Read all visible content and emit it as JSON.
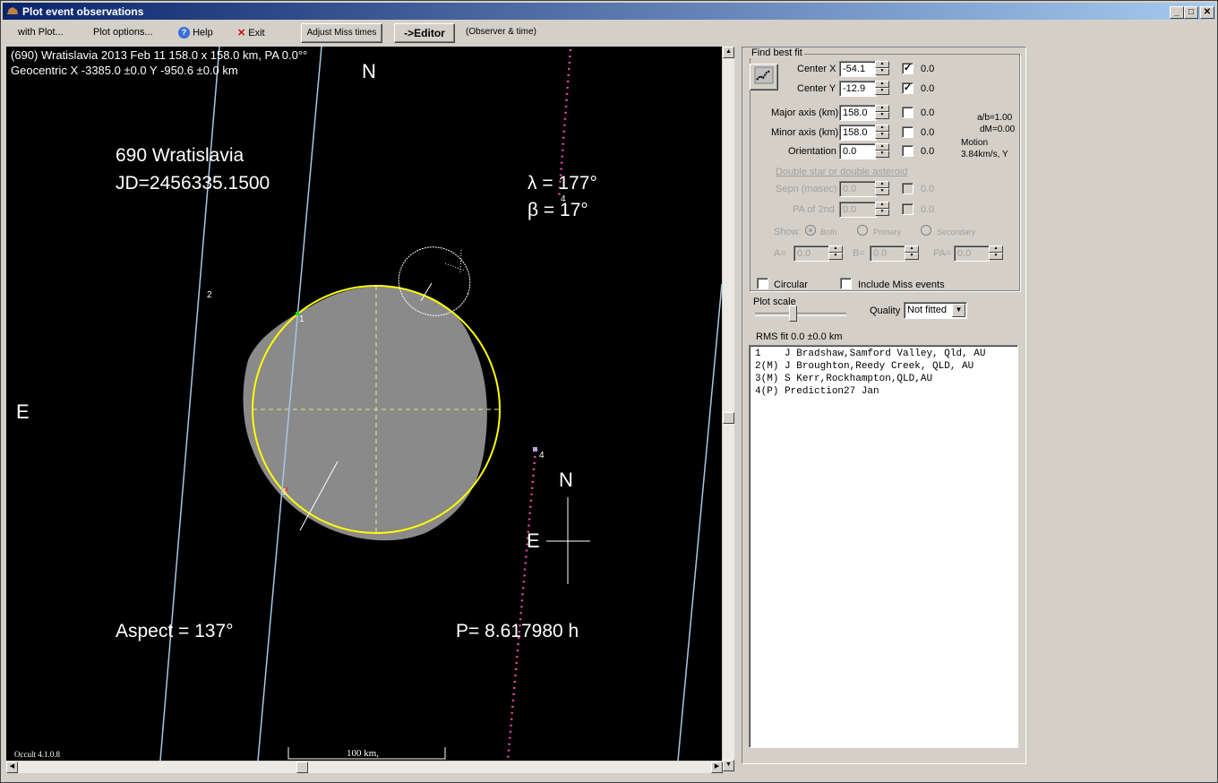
{
  "window": {
    "title": "Plot event observations",
    "controls": {
      "minimize": "_",
      "maximize": "□",
      "close": "✕"
    }
  },
  "menu": {
    "with_plot": "with Plot...",
    "plot_options": "Plot options...",
    "help": "Help",
    "exit": "Exit",
    "adjust_miss": "Adjust Miss times",
    "editor": "->Editor",
    "observer_time": "(Observer & time)"
  },
  "plot": {
    "header_line1": "(690) Wratislavia  2013 Feb 11   158.0 x 158.0 km, PA 0.0°°",
    "header_line2": "Geocentric X -3385.0 ±0.0  Y -950.6 ±0.0 km",
    "north_top": "N",
    "east_left": "E",
    "asteroid_name": "690 Wratislavia",
    "jd": "JD=2456335.1500",
    "lambda": "λ =  177°",
    "beta": "β =   17°",
    "aspect": "Aspect = 137°",
    "period": "P= 8.617980 h",
    "compass_n": "N",
    "compass_e": "E",
    "scale_label": "100 km,",
    "version": "Occult 4.1.0.8",
    "chord_labels": [
      "1",
      "1",
      "2",
      "4",
      "4",
      "3"
    ],
    "colors": {
      "fit_ellipse": "#ffff00",
      "chord": "#a6c8e6",
      "prediction": "#e04aa0",
      "shape": "#888888"
    }
  },
  "fit": {
    "group_title": "Find best fit",
    "center_x": {
      "label": "Center X",
      "value": "-54.1",
      "checked": true,
      "result": "0.0"
    },
    "center_y": {
      "label": "Center Y",
      "value": "-12.9",
      "checked": true,
      "result": "0.0"
    },
    "major_axis": {
      "label": "Major axis (km)",
      "value": "158.0",
      "checked": false,
      "result": "0.0"
    },
    "minor_axis": {
      "label": "Minor axis (km)",
      "value": "158.0",
      "checked": false,
      "result": "0.0"
    },
    "orientation": {
      "label": "Orientation",
      "value": "0.0",
      "checked": false,
      "result": "0.0"
    },
    "ab_ratio": "a/b=1.00",
    "dm": "dM=0.00",
    "motion_label": "Motion",
    "motion_value": "3.84km/s, Y",
    "double_title": "Double star  or  double asteroid",
    "sepn": {
      "label": "Sepn (masec)",
      "value": "0.0",
      "result": "0.0"
    },
    "pa2nd": {
      "label": "PA of 2nd",
      "value": "0.0",
      "result": "0.0"
    },
    "show_label": "Show:",
    "show_options": [
      "Both",
      "Primary",
      "Secondary"
    ],
    "show_selected": "Both",
    "a_label": "A=",
    "a_value": "0.0",
    "b_label": "B=",
    "b_value": "0.0",
    "pa_label": "PA=",
    "pa_value": "0.0"
  },
  "options": {
    "circular": "Circular",
    "include_miss": "Include Miss events",
    "plot_scale": "Plot scale",
    "quality_label": "Quality",
    "quality_value": "Not fitted",
    "rms": "RMS fit 0.0 ±0.0 km"
  },
  "observers": [
    {
      "id": "1   ",
      "name": "J Bradshaw,Samford Valley, Qld, AU"
    },
    {
      "id": "2(M)",
      "name": "J Broughton,Reedy Creek, QLD, AU"
    },
    {
      "id": "3(M)",
      "name": "S Kerr,Rockhampton,QLD,AU"
    },
    {
      "id": "4(P)",
      "name": "Prediction27 Jan"
    }
  ]
}
